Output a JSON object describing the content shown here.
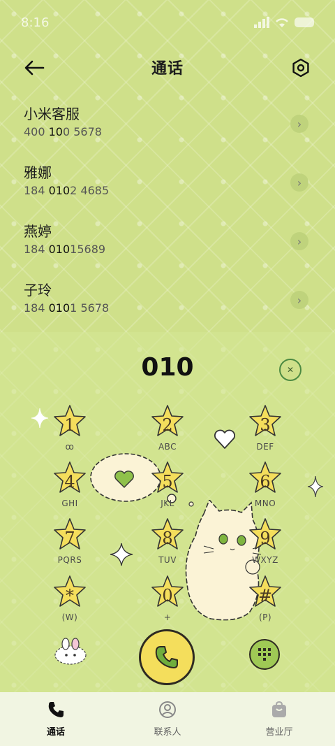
{
  "status_bar": {
    "time": "8:16"
  },
  "header": {
    "title": "通话"
  },
  "contacts": [
    {
      "name": "小米客服",
      "number_parts": [
        "400 ",
        "10",
        "0 5678"
      ]
    },
    {
      "name": "雅娜",
      "number_parts": [
        "184 ",
        "010",
        "2 4685"
      ]
    },
    {
      "name": "燕婷",
      "number_parts": [
        "184 ",
        "010",
        "15689"
      ]
    },
    {
      "name": "子玲",
      "number_parts": [
        "184 ",
        "010",
        "1 5678"
      ]
    }
  ],
  "dialer": {
    "display": "010",
    "keys": [
      {
        "digit": "1",
        "letters": "ꝏ"
      },
      {
        "digit": "2",
        "letters": "ABC"
      },
      {
        "digit": "3",
        "letters": "DEF"
      },
      {
        "digit": "4",
        "letters": "GHI"
      },
      {
        "digit": "5",
        "letters": "JKL"
      },
      {
        "digit": "6",
        "letters": "MNO"
      },
      {
        "digit": "7",
        "letters": "PQRS"
      },
      {
        "digit": "8",
        "letters": "TUV"
      },
      {
        "digit": "9",
        "letters": "WXYZ"
      },
      {
        "digit": "*",
        "letters": "(W)"
      },
      {
        "digit": "0",
        "letters": "+"
      },
      {
        "digit": "#",
        "letters": "(P)"
      }
    ]
  },
  "nav": {
    "items": [
      {
        "label": "通话",
        "icon": "phone-icon",
        "active": true
      },
      {
        "label": "联系人",
        "icon": "contacts-icon",
        "active": false
      },
      {
        "label": "营业厅",
        "icon": "shop-bag-icon",
        "active": false
      }
    ]
  },
  "colors": {
    "background": "#cfe08a",
    "star": "#f4de5c",
    "call_button": "#f4de5c",
    "accent_green": "#9fc955"
  }
}
